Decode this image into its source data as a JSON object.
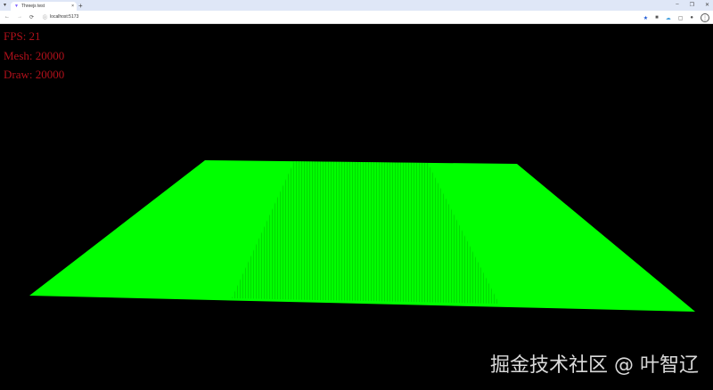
{
  "browser": {
    "tab_title": "Threejs test",
    "url": "localhost:5173",
    "new_tab": "+",
    "close": "×",
    "back": "←",
    "forward": "→",
    "reload": "⟳",
    "minimize": "–",
    "maximize": "❐",
    "close_window": "✕"
  },
  "stats": {
    "fps": "FPS: 21",
    "mesh": "Mesh: 20000",
    "draw": "Draw: 20000"
  },
  "scene": {
    "plane_color": "#00ff00"
  },
  "watermark": "掘金技术社区 @ 叶智辽"
}
